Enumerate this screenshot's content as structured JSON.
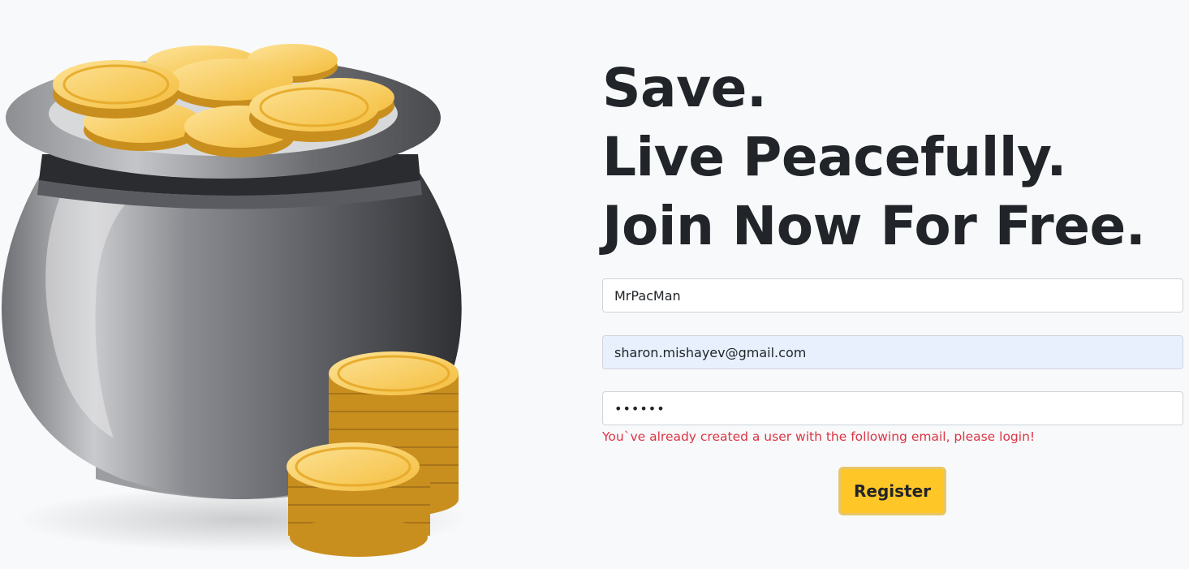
{
  "headline": {
    "line1": "Save.",
    "line2": "Live Peacefully.",
    "line3": "Join Now For Free."
  },
  "form": {
    "username_value": "MrPacMan",
    "email_value": "sharon.mishayev@gmail.com",
    "password_value": "••••••",
    "error_message": "You`ve already created a user with the following email, please login!",
    "register_label": "Register"
  },
  "illustration": {
    "icon": "pot-of-gold-coins",
    "colors": {
      "pot": "#5c5d62",
      "coin": "#f7c548",
      "coin_edge": "#c98f1e"
    }
  },
  "colors": {
    "background": "#f8f9fa",
    "text": "#212529",
    "error": "#dc3545",
    "button": "#ffc628",
    "autofill": "#e8f0fe"
  }
}
